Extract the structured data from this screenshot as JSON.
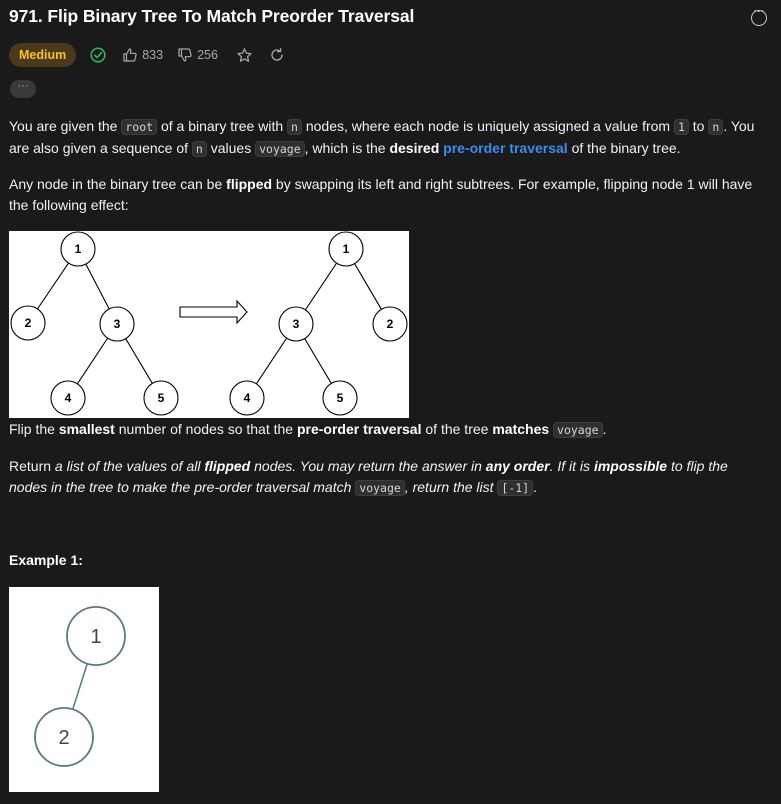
{
  "problem": {
    "title": "971. Flip Binary Tree To Match Preorder Traversal",
    "difficulty": "Medium",
    "likes": "833",
    "dislikes": "256",
    "more_label": "···"
  },
  "description": {
    "p1": [
      {
        "t": "text",
        "v": "You are given the "
      },
      {
        "t": "code",
        "v": "root"
      },
      {
        "t": "text",
        "v": " of a binary tree with "
      },
      {
        "t": "code",
        "v": "n"
      },
      {
        "t": "text",
        "v": " nodes, where each node is uniquely assigned a value from "
      },
      {
        "t": "code",
        "v": "1"
      },
      {
        "t": "text",
        "v": " to "
      },
      {
        "t": "code",
        "v": "n"
      },
      {
        "t": "text",
        "v": ". You are also given a sequence of "
      },
      {
        "t": "code",
        "v": "n"
      },
      {
        "t": "text",
        "v": " values "
      },
      {
        "t": "code",
        "v": "voyage"
      },
      {
        "t": "text",
        "v": ", which is the "
      },
      {
        "t": "bold",
        "v": "desired"
      },
      {
        "t": "text",
        "v": " "
      },
      {
        "t": "link",
        "v": "pre-order traversal"
      },
      {
        "t": "text",
        "v": " of the binary tree."
      }
    ],
    "p2": [
      {
        "t": "text",
        "v": "Any node in the binary tree can be "
      },
      {
        "t": "bold",
        "v": "flipped"
      },
      {
        "t": "text",
        "v": " by swapping its left and right subtrees. For example, flipping node 1 will have the following effect:"
      }
    ],
    "p3": [
      {
        "t": "text",
        "v": "Flip the "
      },
      {
        "t": "bold",
        "v": "smallest"
      },
      {
        "t": "text",
        "v": " number of nodes so that the "
      },
      {
        "t": "bold",
        "v": "pre-order traversal"
      },
      {
        "t": "text",
        "v": " of the tree "
      },
      {
        "t": "bold",
        "v": "matches"
      },
      {
        "t": "text",
        "v": " "
      },
      {
        "t": "code",
        "v": "voyage"
      },
      {
        "t": "text",
        "v": "."
      }
    ],
    "p4": [
      {
        "t": "text",
        "v": "Return "
      },
      {
        "t": "ital",
        "v": "a list of the values of all "
      },
      {
        "t": "boldital",
        "v": "flipped"
      },
      {
        "t": "ital",
        "v": " nodes. You may return the answer in "
      },
      {
        "t": "boldital",
        "v": "any order"
      },
      {
        "t": "ital",
        "v": ". If it is "
      },
      {
        "t": "boldital",
        "v": "impossible"
      },
      {
        "t": "ital",
        "v": " to flip the nodes in the tree to make the pre-order traversal match "
      },
      {
        "t": "code",
        "v": "voyage"
      },
      {
        "t": "ital",
        "v": ", return the list "
      },
      {
        "t": "code",
        "v": "[-1]"
      },
      {
        "t": "text",
        "v": "."
      }
    ]
  },
  "flip_figure": {
    "before": {
      "root": "1",
      "left": "2",
      "right": "3",
      "right_left": "4",
      "right_right": "5"
    },
    "after": {
      "root": "1",
      "left": "3",
      "right": "2",
      "left_left": "4",
      "left_right": "5"
    }
  },
  "example1": {
    "title": "Example 1:",
    "tree": {
      "root": "1",
      "left": "2"
    }
  }
}
